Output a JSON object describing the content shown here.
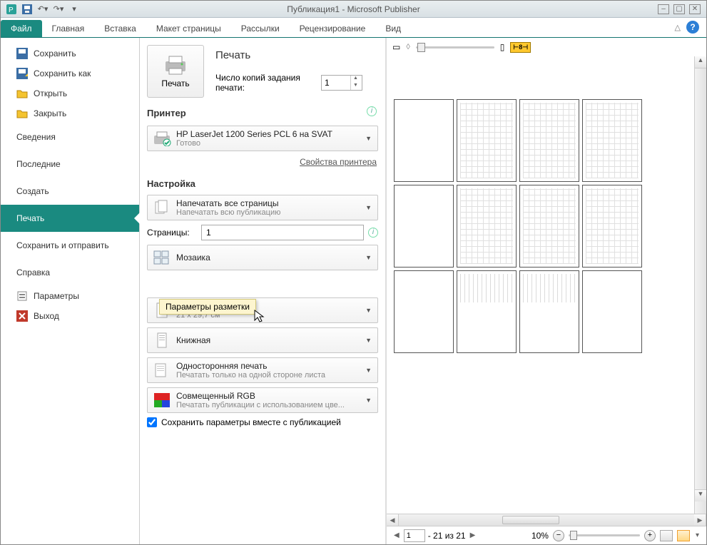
{
  "window": {
    "title": "Публикация1  -  Microsoft Publisher"
  },
  "ribbon": {
    "tabs": [
      "Файл",
      "Главная",
      "Вставка",
      "Макет страницы",
      "Рассылки",
      "Рецензирование",
      "Вид"
    ]
  },
  "backstage": {
    "items": [
      {
        "label": "Сохранить"
      },
      {
        "label": "Сохранить как"
      },
      {
        "label": "Открыть"
      },
      {
        "label": "Закрыть"
      },
      {
        "label": "Сведения"
      },
      {
        "label": "Последние"
      },
      {
        "label": "Создать"
      },
      {
        "label": "Печать"
      },
      {
        "label": "Сохранить и отправить"
      },
      {
        "label": "Справка"
      },
      {
        "label": "Параметры"
      },
      {
        "label": "Выход"
      }
    ]
  },
  "print": {
    "heading": "Печать",
    "big_button": "Печать",
    "copies_label": "Число копий задания печати:",
    "copies_value": "1",
    "printer_heading": "Принтер",
    "printer_name": "HP LaserJet 1200 Series PCL 6 на SVAT",
    "printer_status": "Готово",
    "printer_props": "Свойства принтера",
    "settings_heading": "Настройка",
    "print_all_main": "Напечатать все страницы",
    "print_all_sub": "Напечатать всю публикацию",
    "pages_label": "Страницы:",
    "pages_value": "1",
    "tile_label": "Мозаика",
    "paper_main": "А4",
    "paper_sub": "21 x 29,7 см",
    "orient_label": "Книжная",
    "side_main": "Односторонняя печать",
    "side_sub": "Печатать только на одной стороне листа",
    "color_main": "Совмещенный RGB",
    "color_sub": "Печатать публикации с использованием цве...",
    "save_cb": "Сохранить параметры вместе с публикацией",
    "tooltip": "Параметры разметки"
  },
  "preview": {
    "page_current": "1",
    "page_info": "- 21 из 21",
    "zoom_pct": "10%",
    "badge": "8"
  }
}
